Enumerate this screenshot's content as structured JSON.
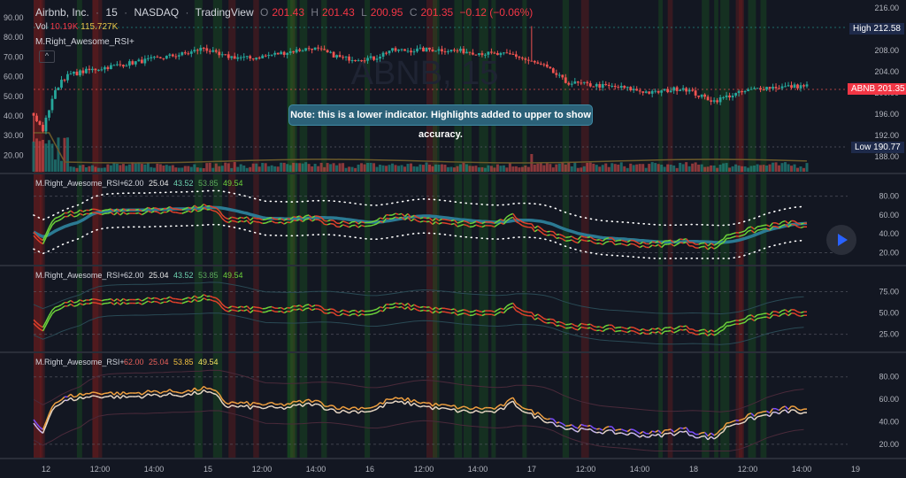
{
  "header": {
    "symbol": "Airbnb, Inc.",
    "interval": "15",
    "exchange": "NASDAQ",
    "source": "TradingView",
    "o_label": "O",
    "o_value": "201.43",
    "h_label": "H",
    "h_value": "201.43",
    "l_label": "L",
    "l_value": "200.95",
    "c_label": "C",
    "c_value": "201.35",
    "change": "−0.12 (−0.06%)"
  },
  "volume": {
    "label": "Vol",
    "value": "10.19K",
    "ma_value": "115.727K"
  },
  "indicator_overlay_name": "M.Right_Awesome_RSI+",
  "collapse_glyph": "^",
  "note": "Note: this is a lower indicator. Highlights added to upper to show accuracy.",
  "tags": {
    "high_label": "High",
    "high_value": "212.58",
    "low_label": "Low",
    "low_value": "190.77",
    "abnb_label": "ABNB",
    "abnb_value": "201.35"
  },
  "watermark": "ABNB, 15",
  "colors": {
    "background": "#131722",
    "up": "#26a69a",
    "down": "#ef5350",
    "rsi_up": "#6dd33a",
    "rsi_down": "#e0412b",
    "rsi_ma": "#2b7a93",
    "band": "#ffffff",
    "orange": "#f0a040",
    "purple": "#7c4dff",
    "highlight_green": "#1b5e20",
    "highlight_red": "#7f1d1d",
    "accent": "#2962ff"
  },
  "chart_data": [
    {
      "type": "candlestick",
      "title": "Airbnb, Inc. · 15 · NASDAQ",
      "price_ylim": [
        186.5,
        216.5
      ],
      "right_axis_ticks": [
        "216.00",
        "212.00",
        "208.00",
        "204.00",
        "200.00",
        "196.00",
        "192.00",
        "188.00"
      ],
      "left_axis_ticks": [
        "90.00",
        "80.00",
        "70.00",
        "60.00",
        "50.00",
        "40.00",
        "30.00",
        "20.00"
      ],
      "x_ticks": [
        "12",
        "12:00",
        "14:00",
        "15",
        "12:00",
        "14:00",
        "16",
        "12:00",
        "14:00",
        "17",
        "12:00",
        "14:00",
        "18",
        "12:00",
        "14:00",
        "19"
      ],
      "close_anchors": [
        [
          0,
          195.5
        ],
        [
          3,
          193.0
        ],
        [
          6,
          199.0
        ],
        [
          9,
          202.5
        ],
        [
          12,
          203.5
        ],
        [
          20,
          204.5
        ],
        [
          30,
          205.5
        ],
        [
          40,
          206.5
        ],
        [
          50,
          207.5
        ],
        [
          55,
          208.5
        ],
        [
          60,
          207.0
        ],
        [
          70,
          206.5
        ],
        [
          80,
          207.5
        ],
        [
          90,
          208.5
        ],
        [
          95,
          207.5
        ],
        [
          100,
          206.5
        ],
        [
          110,
          206.5
        ],
        [
          115,
          208.0
        ],
        [
          120,
          208.0
        ],
        [
          130,
          208.2
        ],
        [
          140,
          207.8
        ],
        [
          150,
          207.2
        ],
        [
          155,
          207.2
        ],
        [
          160,
          206.0
        ],
        [
          165,
          205.0
        ],
        [
          170,
          203.0
        ],
        [
          172,
          202.0
        ],
        [
          180,
          201.5
        ],
        [
          190,
          201.0
        ],
        [
          200,
          200.0
        ],
        [
          210,
          201.0
        ],
        [
          215,
          199.5
        ],
        [
          220,
          198.5
        ],
        [
          225,
          199.5
        ],
        [
          235,
          201.0
        ],
        [
          245,
          201.2
        ],
        [
          250,
          201.35
        ]
      ],
      "last_close": 201.35,
      "high": 212.58,
      "low": 190.77
    },
    {
      "type": "line",
      "title": "M.Right_Awesome_RSI+",
      "legend_values": [
        "62.00",
        "25.04",
        "43.52",
        "53.85",
        "49.54"
      ],
      "y_ticks": [
        "80.00",
        "60.00",
        "40.00",
        "20.00"
      ],
      "ylim": [
        12,
        90
      ],
      "rsi_anchors": [
        [
          0,
          40
        ],
        [
          3,
          33
        ],
        [
          6,
          55
        ],
        [
          9,
          60
        ],
        [
          12,
          63
        ],
        [
          20,
          66
        ],
        [
          30,
          65
        ],
        [
          40,
          67
        ],
        [
          50,
          67
        ],
        [
          55,
          70
        ],
        [
          60,
          65
        ],
        [
          62,
          57
        ],
        [
          70,
          56
        ],
        [
          80,
          55
        ],
        [
          90,
          59
        ],
        [
          95,
          55
        ],
        [
          100,
          52
        ],
        [
          110,
          53
        ],
        [
          115,
          60
        ],
        [
          120,
          60
        ],
        [
          130,
          55
        ],
        [
          140,
          52
        ],
        [
          150,
          52
        ],
        [
          155,
          60
        ],
        [
          160,
          50
        ],
        [
          165,
          45
        ],
        [
          170,
          40
        ],
        [
          172,
          37
        ],
        [
          180,
          35
        ],
        [
          190,
          33
        ],
        [
          200,
          30
        ],
        [
          210,
          34
        ],
        [
          215,
          30
        ],
        [
          220,
          28
        ],
        [
          225,
          40
        ],
        [
          235,
          48
        ],
        [
          245,
          53
        ],
        [
          250,
          49.5
        ]
      ],
      "signal_value": 43.52
    },
    {
      "type": "line",
      "title": "M.Right_Awesome_RSI+",
      "legend_values": [
        "62.00",
        "25.04",
        "43.52",
        "53.85",
        "49.54"
      ],
      "y_ticks": [
        "75.00",
        "50.00",
        "25.00"
      ],
      "ylim": [
        10,
        90
      ]
    },
    {
      "type": "line",
      "title": "M.Right_Awesome_RSI+",
      "legend_values": [
        "62.00",
        "25.04",
        "53.85",
        "49.54"
      ],
      "y_ticks": [
        "80.00",
        "60.00",
        "40.00",
        "20.00"
      ],
      "ylim": [
        12,
        90
      ]
    }
  ]
}
